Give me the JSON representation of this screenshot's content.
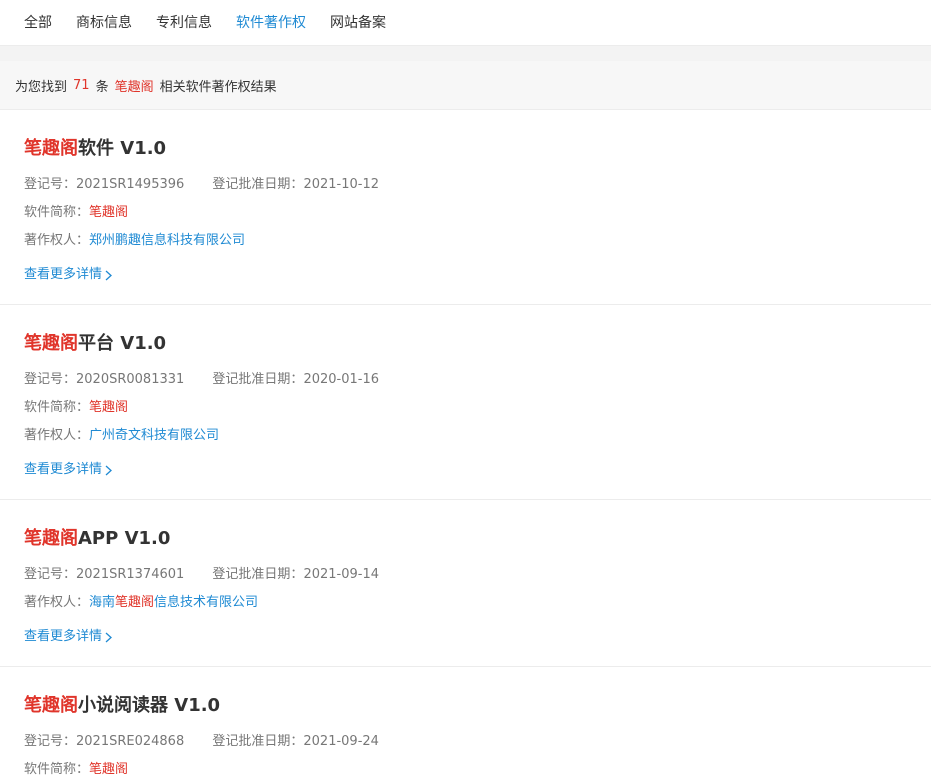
{
  "tabs": [
    {
      "label": "全部",
      "active": false
    },
    {
      "label": "商标信息",
      "active": false
    },
    {
      "label": "专利信息",
      "active": false
    },
    {
      "label": "软件著作权",
      "active": true
    },
    {
      "label": "网站备案",
      "active": false
    }
  ],
  "summary": {
    "prefix": "为您找到",
    "count": "71",
    "unit": "条",
    "keyword": "笔趣阁",
    "suffix": "相关软件著作权结果"
  },
  "labels": {
    "reg_no": "登记号：",
    "approve_date": "登记批准日期：",
    "short_name": "软件简称：",
    "owner": "著作权人：",
    "more": "查看更多详情"
  },
  "results": [
    {
      "title_kw": "笔趣阁",
      "title_rest": "软件 V1.0",
      "reg_no": "2021SR1495396",
      "approve_date": "2021-10-12",
      "short_name": "笔趣阁",
      "owner_pre": "郑州鹏趣信息科技有限公司",
      "owner_kw": "",
      "owner_post": ""
    },
    {
      "title_kw": "笔趣阁",
      "title_rest": "平台 V1.0",
      "reg_no": "2020SR0081331",
      "approve_date": "2020-01-16",
      "short_name": "笔趣阁",
      "owner_pre": "广州奇文科技有限公司",
      "owner_kw": "",
      "owner_post": ""
    },
    {
      "title_kw": "笔趣阁",
      "title_rest": "APP V1.0",
      "reg_no": "2021SR1374601",
      "approve_date": "2021-09-14",
      "short_name": "",
      "owner_pre": "海南",
      "owner_kw": "笔趣阁",
      "owner_post": "信息技术有限公司"
    },
    {
      "title_kw": "笔趣阁",
      "title_rest": "小说阅读器 V1.0",
      "reg_no": "2021SRE024868",
      "approve_date": "2021-09-24",
      "short_name": "笔趣阁"
    }
  ],
  "icons": {
    "more_arrow": "chevron-right-icon"
  },
  "colors": {
    "accent": "#1f8ad3",
    "keyword": "#e0352b"
  }
}
